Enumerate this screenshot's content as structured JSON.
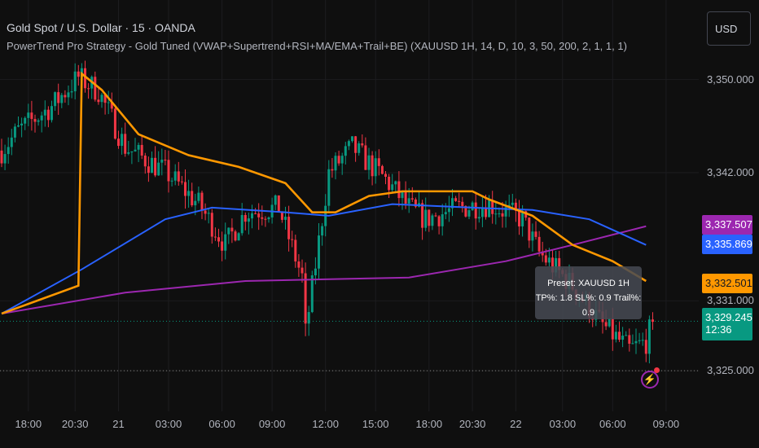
{
  "header": {
    "symbol_title": "Gold Spot / U.S. Dollar · 15 · OANDA",
    "indicator": "PowerTrend Pro Strategy - Gold Tuned (VWAP+Supertrend+RSI+MA/EMA+Trail+BE) (XAUUSD 1H, 14, D, 10, 3, 50, 200, 2, 1, 1, 1)",
    "currency_button": "USD"
  },
  "price_axis": [
    {
      "label": "3,350.000",
      "value": 3350
    },
    {
      "label": "3,342.000",
      "value": 3342
    },
    {
      "label": "3,331.000",
      "value": 3331
    },
    {
      "label": "3,325.000",
      "value": 3325
    }
  ],
  "price_tags": [
    {
      "label": "3,337.507",
      "value": 3337.507,
      "color": "#9c27b0",
      "text": "#ffffff"
    },
    {
      "label": "3,335.869",
      "value": 3335.869,
      "color": "#2962ff",
      "text": "#ffffff"
    },
    {
      "label": "3,332.501",
      "value": 3332.501,
      "color": "#ff9800",
      "text": "#131722"
    }
  ],
  "last_price": {
    "label": "3,329.245",
    "countdown": "12:36",
    "value": 3329.245,
    "color": "#089981"
  },
  "time_axis": [
    {
      "label": "18:00",
      "bar": 8
    },
    {
      "label": "20:30",
      "bar": 22
    },
    {
      "label": "21",
      "bar": 35
    },
    {
      "label": "03:00",
      "bar": 50
    },
    {
      "label": "06:00",
      "bar": 66
    },
    {
      "label": "09:00",
      "bar": 81
    },
    {
      "label": "12:00",
      "bar": 97
    },
    {
      "label": "15:00",
      "bar": 112
    },
    {
      "label": "18:00",
      "bar": 128
    },
    {
      "label": "20:30",
      "bar": 141
    },
    {
      "label": "22",
      "bar": 154
    },
    {
      "label": "03:00",
      "bar": 168
    },
    {
      "label": "06:00",
      "bar": 183
    },
    {
      "label": "09:00",
      "bar": 199
    }
  ],
  "tooltip": {
    "line1": "Preset: XAUUSD 1H",
    "line2": "TP%: 1.8  SL%: 0.9  Trail%: 0.9"
  },
  "colors": {
    "up": "#089981",
    "down": "#f23645",
    "orange": "#ff9800",
    "blue": "#2962ff",
    "purple": "#9c27b0"
  },
  "series": {
    "price": [
      [
        0,
        3343.9
      ],
      [
        5,
        3345.6
      ],
      [
        15,
        3347.7
      ],
      [
        23,
        3350.2
      ],
      [
        29,
        3349
      ],
      [
        37,
        3344.2
      ],
      [
        49,
        3342.1
      ],
      [
        59,
        3339.3
      ],
      [
        67,
        3335.8
      ],
      [
        73,
        3338.6
      ],
      [
        83,
        3339
      ],
      [
        90,
        3333
      ],
      [
        91,
        3328.2
      ],
      [
        98,
        3342
      ],
      [
        105,
        3344.2
      ],
      [
        115,
        3341.4
      ],
      [
        122,
        3339
      ],
      [
        127,
        3338
      ],
      [
        137,
        3339
      ],
      [
        146,
        3339.3
      ],
      [
        156,
        3338
      ],
      [
        161,
        3335.1
      ],
      [
        171,
        3332.3
      ],
      [
        180,
        3328.9
      ],
      [
        188,
        3326.8
      ],
      [
        193,
        3327.5
      ],
      [
        195,
        3329.2
      ]
    ],
    "orange": [
      [
        0,
        3329.9
      ],
      [
        23,
        3332.3
      ],
      [
        24,
        3350.5
      ],
      [
        30,
        3349.1
      ],
      [
        41,
        3345.3
      ],
      [
        56,
        3343.5
      ],
      [
        71,
        3342.5
      ],
      [
        85,
        3341.1
      ],
      [
        93,
        3338.6
      ],
      [
        100,
        3338.6
      ],
      [
        110,
        3340
      ],
      [
        120,
        3340.4
      ],
      [
        141,
        3340.4
      ],
      [
        146,
        3339.7
      ],
      [
        159,
        3338.3
      ],
      [
        171,
        3335.8
      ],
      [
        183,
        3334.4
      ],
      [
        193,
        3332.7
      ]
    ],
    "blue": [
      [
        0,
        3329.9
      ],
      [
        24,
        3333.7
      ],
      [
        49,
        3338
      ],
      [
        63,
        3339
      ],
      [
        85,
        3338.6
      ],
      [
        98,
        3338.3
      ],
      [
        117,
        3339.3
      ],
      [
        141,
        3339
      ],
      [
        159,
        3338.8
      ],
      [
        176,
        3338
      ],
      [
        193,
        3335.8
      ]
    ],
    "purple": [
      [
        0,
        3329.9
      ],
      [
        37,
        3331.7
      ],
      [
        73,
        3332.7
      ],
      [
        122,
        3333
      ],
      [
        151,
        3334.4
      ],
      [
        171,
        3335.8
      ],
      [
        193,
        3337.4
      ]
    ]
  }
}
